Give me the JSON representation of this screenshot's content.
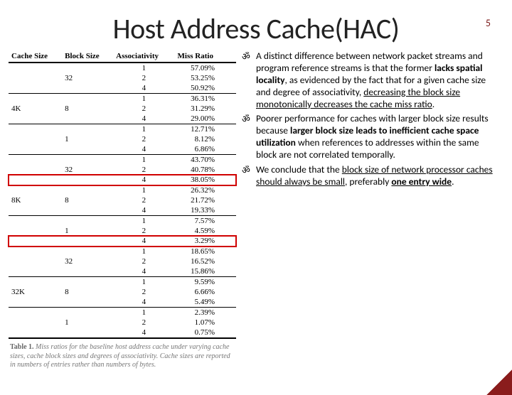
{
  "page_number": "5",
  "title": "Host Address Cache(HAC)",
  "table": {
    "headers": {
      "c0": "Cache Size",
      "c1": "Block Size",
      "c2": "Associativity",
      "c3": "Miss Ratio"
    },
    "rows": [
      {
        "cs": "",
        "bs": "",
        "a": "1",
        "r": "57.09%",
        "group": false
      },
      {
        "cs": "",
        "bs": "32",
        "a": "2",
        "r": "53.25%",
        "group": false
      },
      {
        "cs": "",
        "bs": "",
        "a": "4",
        "r": "50.92%",
        "group": false
      },
      {
        "cs": "",
        "bs": "",
        "a": "1",
        "r": "36.31%",
        "group": true
      },
      {
        "cs": "4K",
        "bs": "8",
        "a": "2",
        "r": "31.29%",
        "group": false
      },
      {
        "cs": "",
        "bs": "",
        "a": "4",
        "r": "29.00%",
        "group": false
      },
      {
        "cs": "",
        "bs": "",
        "a": "1",
        "r": "12.71%",
        "group": true
      },
      {
        "cs": "",
        "bs": "1",
        "a": "2",
        "r": "8.12%",
        "group": false
      },
      {
        "cs": "",
        "bs": "",
        "a": "4",
        "r": "6.86%",
        "group": false
      },
      {
        "cs": "",
        "bs": "",
        "a": "1",
        "r": "43.70%",
        "group": true
      },
      {
        "cs": "",
        "bs": "32",
        "a": "2",
        "r": "40.78%",
        "group": false
      },
      {
        "cs": "",
        "bs": "",
        "a": "4",
        "r": "38.05%",
        "group": false,
        "highlight": true
      },
      {
        "cs": "",
        "bs": "",
        "a": "1",
        "r": "26.32%",
        "group": true
      },
      {
        "cs": "8K",
        "bs": "8",
        "a": "2",
        "r": "21.72%",
        "group": false
      },
      {
        "cs": "",
        "bs": "",
        "a": "4",
        "r": "19.33%",
        "group": false
      },
      {
        "cs": "",
        "bs": "",
        "a": "1",
        "r": "7.57%",
        "group": true
      },
      {
        "cs": "",
        "bs": "1",
        "a": "2",
        "r": "4.59%",
        "group": false
      },
      {
        "cs": "",
        "bs": "",
        "a": "4",
        "r": "3.29%",
        "group": false,
        "highlight": true
      },
      {
        "cs": "",
        "bs": "",
        "a": "1",
        "r": "18.65%",
        "group": true
      },
      {
        "cs": "",
        "bs": "32",
        "a": "2",
        "r": "16.52%",
        "group": false
      },
      {
        "cs": "",
        "bs": "",
        "a": "4",
        "r": "15.86%",
        "group": false
      },
      {
        "cs": "",
        "bs": "",
        "a": "1",
        "r": "9.59%",
        "group": true
      },
      {
        "cs": "32K",
        "bs": "8",
        "a": "2",
        "r": "6.66%",
        "group": false
      },
      {
        "cs": "",
        "bs": "",
        "a": "4",
        "r": "5.49%",
        "group": false
      },
      {
        "cs": "",
        "bs": "",
        "a": "1",
        "r": "2.39%",
        "group": true
      },
      {
        "cs": "",
        "bs": "1",
        "a": "2",
        "r": "1.07%",
        "group": false
      },
      {
        "cs": "",
        "bs": "",
        "a": "4",
        "r": "0.75%",
        "group": false
      }
    ]
  },
  "caption": {
    "label": "Table 1.",
    "text": " Miss ratios for the baseline host address cache under varying cache sizes, cache block sizes and degrees of associativity. Cache sizes are reported in numbers of entries rather than numbers of bytes."
  },
  "bullets": {
    "p1": {
      "t1": "A distinct difference between network packet streams and program reference streams is that the former ",
      "b1": "lacks spatial locality",
      "t2": ", as evidenced by the fact that for a given cache size and degree of associativity, ",
      "u1": "decreasing the block size monotonically decreases the cache miss ratio",
      "t3": "."
    },
    "p2": {
      "t1": "Poorer performance for caches with larger block size results because ",
      "b1": "larger block size leads to inefficient cache space utilization",
      "t2": " when references to addresses within the same block are not correlated temporally."
    },
    "p3": {
      "t1": "We conclude that the ",
      "u1": "block size of network processor caches should always be small",
      "t2": ", preferably ",
      "b1": "one entry wide",
      "t3": "."
    }
  }
}
